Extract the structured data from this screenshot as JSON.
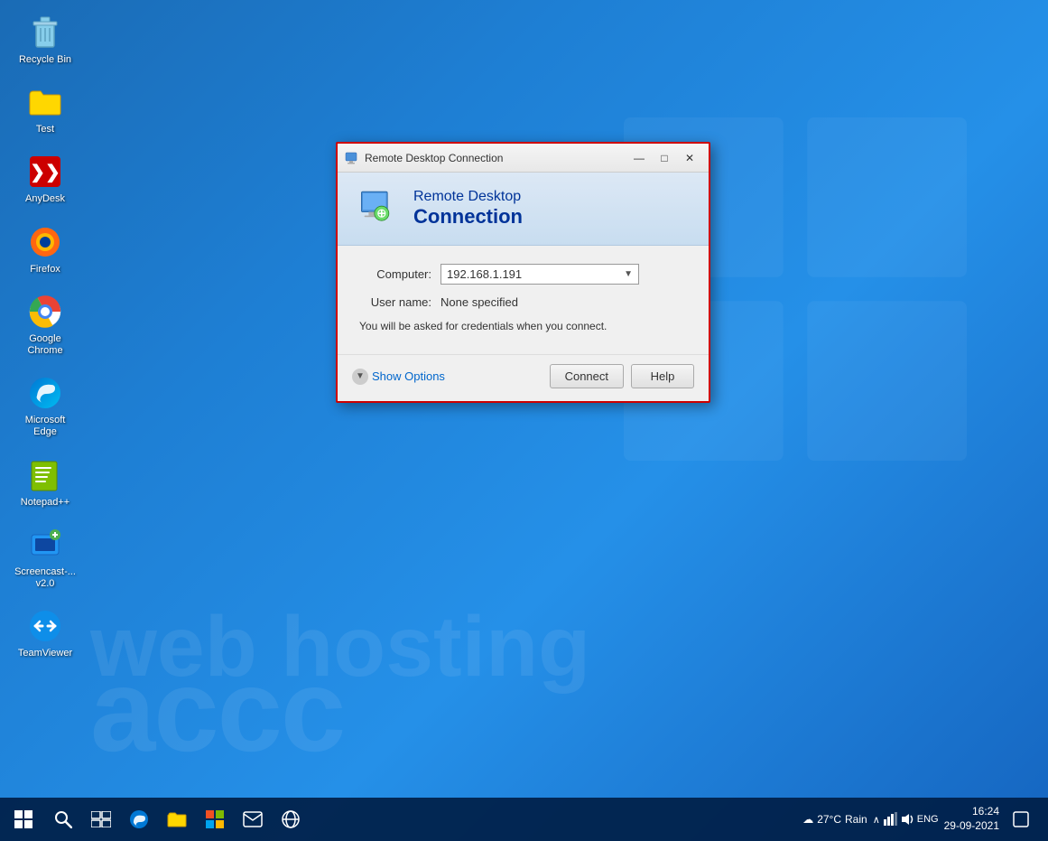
{
  "desktop": {
    "icons": [
      {
        "id": "recycle-bin",
        "label": "Recycle Bin",
        "emoji": "🗑️"
      },
      {
        "id": "test",
        "label": "Test",
        "emoji": "📁"
      },
      {
        "id": "anydesk",
        "label": "AnyDesk",
        "emoji": "❯❯"
      },
      {
        "id": "firefox",
        "label": "Firefox",
        "emoji": "🦊"
      },
      {
        "id": "google-chrome",
        "label": "Google Chrome",
        "emoji": "⊕"
      },
      {
        "id": "microsoft-edge",
        "label": "Microsoft Edge",
        "emoji": "🌀"
      },
      {
        "id": "notepadpp",
        "label": "Notepad++",
        "emoji": "📝"
      },
      {
        "id": "screencast",
        "label": "Screencast-...\nv2.0",
        "emoji": "📷"
      },
      {
        "id": "teamviewer",
        "label": "TeamViewer",
        "emoji": "↔"
      }
    ],
    "watermark_line1": "accc",
    "watermark_line2": "web hosting"
  },
  "dialog": {
    "title": "Remote Desktop Connection",
    "header_line1": "Remote Desktop",
    "header_line2": "Connection",
    "computer_label": "Computer:",
    "computer_value": "192.168.1.191",
    "username_label": "User name:",
    "username_value": "None specified",
    "credential_note": "You will be asked for credentials when you connect.",
    "show_options_label": "Show Options",
    "connect_button": "Connect",
    "help_button": "Help"
  },
  "taskbar": {
    "weather_icon": "☁",
    "weather_temp": "27°C",
    "weather_desc": "Rain",
    "language": "ENG",
    "time": "16:24",
    "date": "29-09-2021",
    "taskbar_icons": [
      "⊞",
      "⊙",
      "▦",
      "🌐",
      "📁",
      "⊞",
      "✉",
      "🌐"
    ]
  },
  "titlebar_controls": {
    "minimize": "—",
    "maximize": "□",
    "close": "✕"
  }
}
